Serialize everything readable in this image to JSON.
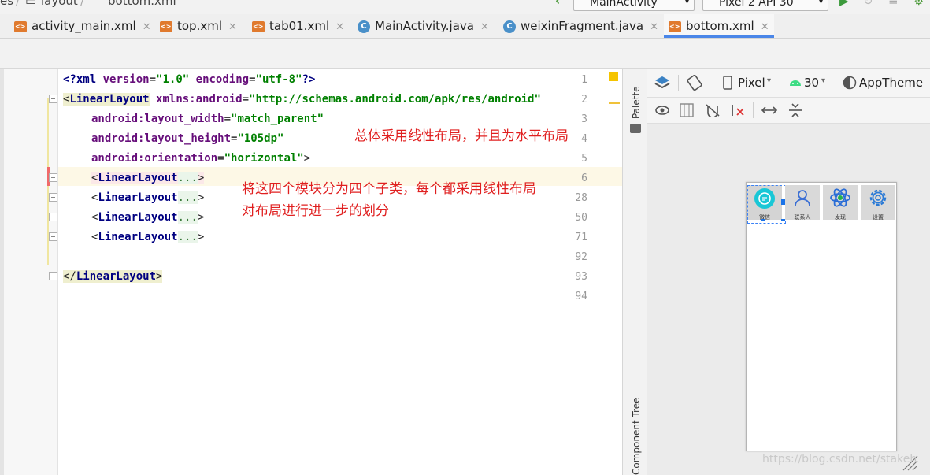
{
  "breadcrumb": {
    "seg1": "es",
    "seg2": "layout",
    "seg3": "bottom.xml"
  },
  "run_config": {
    "label": "MainActivity"
  },
  "device_selector": {
    "label": "Pixel 2 API 30"
  },
  "tabs": [
    {
      "label": "activity_main.xml",
      "icon": "xml-file-icon"
    },
    {
      "label": "top.xml",
      "icon": "xml-file-icon"
    },
    {
      "label": "tab01.xml",
      "icon": "xml-file-icon"
    },
    {
      "label": "MainActivity.java",
      "icon": "java-class-icon"
    },
    {
      "label": "weixinFragment.java",
      "icon": "java-class-icon"
    },
    {
      "label": "bottom.xml",
      "icon": "xml-file-icon",
      "active": true
    }
  ],
  "editor": {
    "line_numbers": [
      "1",
      "2",
      "3",
      "4",
      "5",
      "6",
      "28",
      "50",
      "71",
      "92",
      "93",
      "94"
    ],
    "xml_decl": {
      "open": "<?",
      "name": "xml",
      "a1": "version",
      "v1": "\"1.0\"",
      "a2": "encoding",
      "v2": "\"utf-8\"",
      "close": "?>"
    },
    "root": {
      "lt": "<",
      "tag": "LinearLayout",
      "ns_attr": "xmlns:android",
      "ns_val": "\"http://schemas.android.com/apk/res/android\""
    },
    "attrs": [
      {
        "name": "android:layout_width",
        "value": "\"match_parent\""
      },
      {
        "name": "android:layout_height",
        "value": "\"105dp\""
      },
      {
        "name": "android:orientation",
        "value": "\"horizontal\"",
        "close": ">"
      }
    ],
    "children": [
      {
        "lt": "<",
        "tag": "LinearLayout",
        "ellipsis": "...",
        "gt": ">"
      },
      {
        "lt": "<",
        "tag": "LinearLayout",
        "ellipsis": "...",
        "gt": ">"
      },
      {
        "lt": "<",
        "tag": "LinearLayout",
        "ellipsis": "...",
        "gt": ">"
      },
      {
        "lt": "<",
        "tag": "LinearLayout",
        "ellipsis": "...",
        "gt": ">"
      }
    ],
    "closing_tag": {
      "open": "</",
      "tag": "LinearLayout",
      "close": ">"
    }
  },
  "annotations": {
    "a1": "总体采用线性布局，并且为水平布局",
    "a2": "将这四个模块分为四个子类，每个都采用线性布局",
    "a3": "对布局进行进一步的划分"
  },
  "side_tabs": {
    "palette": "Palette",
    "component_tree": "Component Tree"
  },
  "design_toolbar": {
    "device": "Pixel",
    "api": "30",
    "theme": "AppTheme"
  },
  "preview": {
    "items": [
      {
        "label": "微信",
        "icon": "chat-bubble-icon",
        "selected": true
      },
      {
        "label": "联系人",
        "icon": "person-icon"
      },
      {
        "label": "发现",
        "icon": "atom-icon"
      },
      {
        "label": "设置",
        "icon": "gear-icon"
      }
    ]
  },
  "watermark": "https://blog.csdn.net/stakeh",
  "colors": {
    "accent": "#4a86e8",
    "annotation": "#e02020",
    "tag": "#000080",
    "attr": "#660e7a",
    "value": "#008000"
  }
}
